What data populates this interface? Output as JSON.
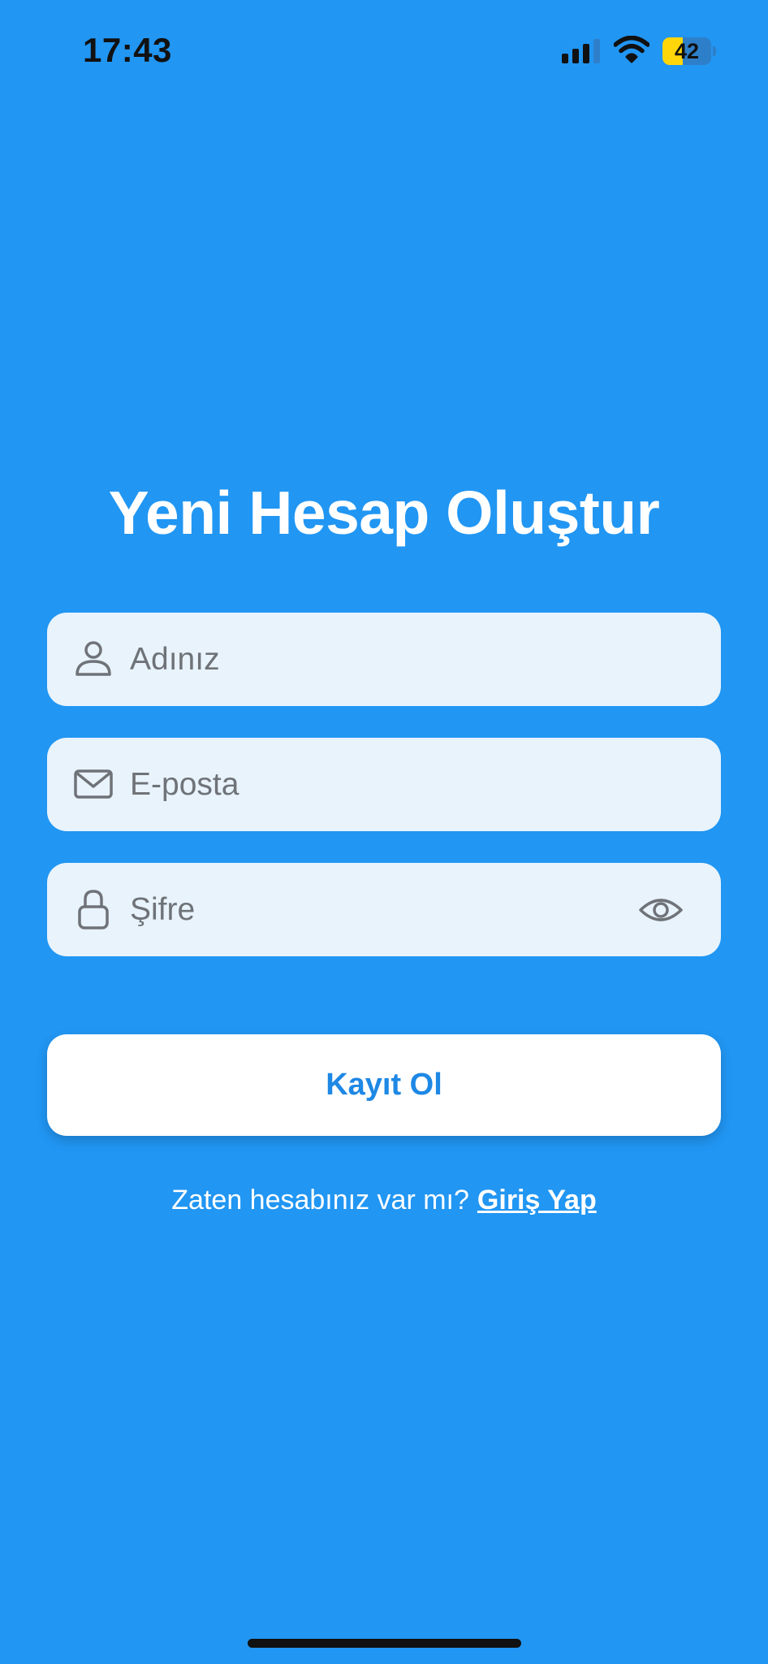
{
  "status_bar": {
    "time": "17:43",
    "battery_level": "42",
    "battery_fraction": 0.42,
    "signal_bars_active": 3,
    "signal_bars_total": 4,
    "text_color": "#111111"
  },
  "colors": {
    "background": "#2196F3",
    "field_background": "#E8F3FC",
    "button_background": "#FFFFFF",
    "button_text": "#1E88E5",
    "battery_accent": "#FFD60A",
    "icon_gray": "#6F7378"
  },
  "form": {
    "title": "Yeni Hesap Oluştur",
    "name_field": {
      "placeholder": "Adınız",
      "icon": "person-icon"
    },
    "email_field": {
      "placeholder": "E-posta",
      "icon": "mail-icon"
    },
    "password_field": {
      "placeholder": "Şifre",
      "icon": "lock-icon",
      "toggle_icon": "eye-icon"
    },
    "submit_label": "Kayıt Ol"
  },
  "footer": {
    "prompt": "Zaten hesabınız var mı?",
    "link_label": "Giriş Yap"
  }
}
